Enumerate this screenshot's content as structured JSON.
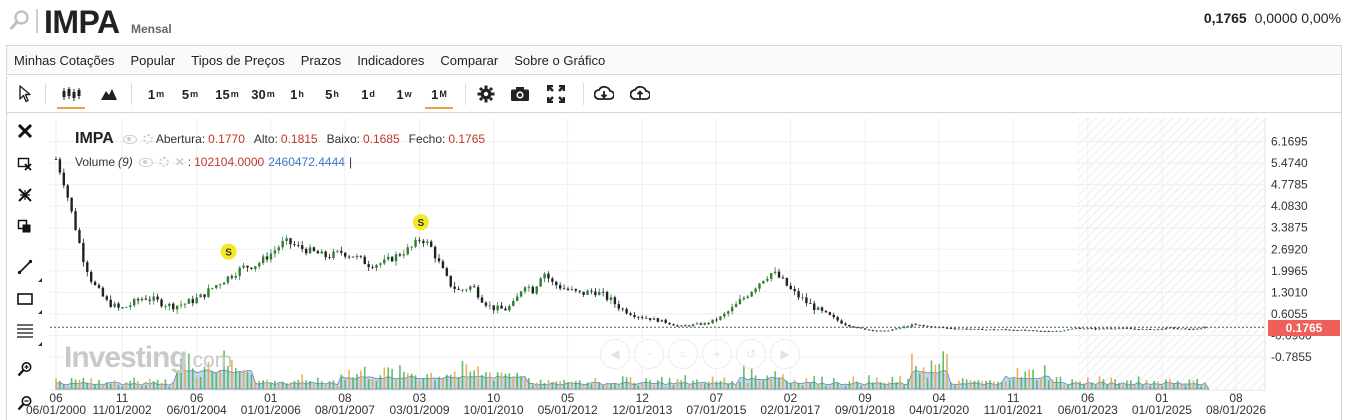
{
  "header": {
    "symbol": "IMPA",
    "period": "Mensal",
    "last": "0,1765",
    "change": "0,0000",
    "change_pct": "0,00%"
  },
  "menu": [
    "Minhas Cotações",
    "Popular",
    "Tipos de Preços",
    "Prazos",
    "Indicadores",
    "Comparar",
    "Sobre o Gráfico"
  ],
  "toolbar": {
    "intervals": [
      {
        "n": "1",
        "u": "m"
      },
      {
        "n": "5",
        "u": "m"
      },
      {
        "n": "15",
        "u": "m"
      },
      {
        "n": "30",
        "u": "m"
      },
      {
        "n": "1",
        "u": "h"
      },
      {
        "n": "5",
        "u": "h"
      },
      {
        "n": "1",
        "u": "d"
      },
      {
        "n": "1",
        "u": "w"
      },
      {
        "n": "1",
        "u": "M"
      }
    ],
    "active_interval": "1M",
    "icons": [
      "cursor-icon",
      "candlestick-icon",
      "mountain-chart-icon",
      "settings-gear-icon",
      "camera-icon",
      "fullscreen-icon",
      "download-icon",
      "upload-icon"
    ]
  },
  "left_tools": [
    "close-icon",
    "delete-drawing-icon",
    "remove-all-icon",
    "copy-icon",
    "trendline-icon",
    "rectangle-icon",
    "fibonacci-icon",
    "zoom-in-icon",
    "zoom-out-icon"
  ],
  "legend": {
    "name": "IMPA",
    "open_label": "Abertura:",
    "open": "0.1770",
    "high_label": "Alto:",
    "high": "0.1815",
    "low_label": "Baixo:",
    "low": "0.1685",
    "close_label": "Fecho:",
    "close": "0.1765",
    "volume_label": "Volume",
    "volume_period": "(9)",
    "volume_sep": ":",
    "volume_value": "102104.0000",
    "volume_ma": "2460472.4444",
    "volume_cursor": "|"
  },
  "price_tag": "0.1765",
  "watermark": {
    "brand": "Investing",
    "domain": ".com"
  },
  "colors": {
    "up": "#2e7d32",
    "down": "#222222",
    "volume_up": "#4caf50",
    "volume_down": "#e8a33d",
    "volume_area": "#7ea3d8",
    "price_tag": "#f0605a",
    "marker": "#f4e922",
    "accent": "#e8a33d"
  },
  "chart_data": {
    "type": "line",
    "y_axis": {
      "ticks": [
        "6.1695",
        "5.4740",
        "4.7785",
        "4.0830",
        "3.3875",
        "2.6920",
        "1.9965",
        "1.3010",
        "0.6055",
        "-0.0900",
        "-0.7855"
      ],
      "tick_values": [
        6.1695,
        5.474,
        4.7785,
        4.083,
        3.3875,
        2.692,
        1.9965,
        1.301,
        0.6055,
        -0.09,
        -0.7855
      ],
      "range": [
        -0.7855,
        6.1695
      ]
    },
    "x_axis": {
      "months": [
        "06",
        "11",
        "06",
        "01",
        "08",
        "03",
        "10",
        "05",
        "12",
        "07",
        "02",
        "09",
        "04",
        "11",
        "06",
        "01",
        "08"
      ],
      "dates": [
        "06/01/2000",
        "11/01/2002",
        "06/01/2004",
        "01/01/2006",
        "08/01/2007",
        "03/01/2009",
        "10/01/2010",
        "05/01/2012",
        "12/01/2013",
        "07/01/2015",
        "02/01/2017",
        "09/01/2018",
        "04/01/2020",
        "11/01/2021",
        "06/01/2023",
        "01/01/2025",
        "08/01/2026"
      ],
      "tick_years": [
        2000.42,
        2001.83,
        2003.42,
        2005.0,
        2006.58,
        2008.17,
        2009.75,
        2011.33,
        2012.92,
        2014.5,
        2016.08,
        2017.67,
        2019.25,
        2020.83,
        2022.42,
        2024.0,
        2025.58
      ]
    },
    "series": [
      {
        "name": "IMPA",
        "points": [
          [
            2000.42,
            5.6
          ],
          [
            2000.6,
            4.8
          ],
          [
            2000.8,
            3.6
          ],
          [
            2001.0,
            2.4
          ],
          [
            2001.2,
            1.6
          ],
          [
            2001.5,
            1.0
          ],
          [
            2001.8,
            0.75
          ],
          [
            2002.0,
            0.9
          ],
          [
            2002.3,
            1.15
          ],
          [
            2002.6,
            1.0
          ],
          [
            2002.9,
            0.85
          ],
          [
            2003.2,
            0.95
          ],
          [
            2003.5,
            1.15
          ],
          [
            2003.8,
            1.5
          ],
          [
            2004.1,
            1.8
          ],
          [
            2004.4,
            2.1
          ],
          [
            2004.7,
            2.2
          ],
          [
            2005.0,
            2.55
          ],
          [
            2005.3,
            2.95
          ],
          [
            2005.6,
            2.75
          ],
          [
            2005.9,
            2.6
          ],
          [
            2006.2,
            2.45
          ],
          [
            2006.5,
            2.6
          ],
          [
            2006.8,
            2.45
          ],
          [
            2007.1,
            2.2
          ],
          [
            2007.4,
            2.25
          ],
          [
            2007.7,
            2.5
          ],
          [
            2008.0,
            2.75
          ],
          [
            2008.2,
            3.05
          ],
          [
            2008.4,
            2.8
          ],
          [
            2008.6,
            2.2
          ],
          [
            2008.8,
            1.6
          ],
          [
            2009.0,
            1.35
          ],
          [
            2009.3,
            1.5
          ],
          [
            2009.5,
            1.1
          ],
          [
            2009.7,
            0.8
          ],
          [
            2010.0,
            0.75
          ],
          [
            2010.2,
            0.95
          ],
          [
            2010.4,
            1.6
          ],
          [
            2010.6,
            1.35
          ],
          [
            2010.8,
            2.0
          ],
          [
            2011.0,
            1.6
          ],
          [
            2011.3,
            1.4
          ],
          [
            2011.6,
            1.25
          ],
          [
            2011.9,
            1.35
          ],
          [
            2012.2,
            1.1
          ],
          [
            2012.5,
            0.75
          ],
          [
            2012.8,
            0.55
          ],
          [
            2013.1,
            0.45
          ],
          [
            2013.4,
            0.35
          ],
          [
            2013.7,
            0.2
          ],
          [
            2014.0,
            0.25
          ],
          [
            2014.3,
            0.3
          ],
          [
            2014.6,
            0.5
          ],
          [
            2014.9,
            0.85
          ],
          [
            2015.2,
            1.3
          ],
          [
            2015.5,
            1.75
          ],
          [
            2015.7,
            1.95
          ],
          [
            2015.9,
            1.7
          ],
          [
            2016.1,
            1.35
          ],
          [
            2016.4,
            1.0
          ],
          [
            2016.7,
            0.7
          ],
          [
            2016.9,
            0.55
          ],
          [
            2017.2,
            0.3
          ],
          [
            2017.5,
            0.15
          ],
          [
            2017.8,
            0.08
          ],
          [
            2018.1,
            0.05
          ],
          [
            2018.4,
            0.15
          ],
          [
            2018.7,
            0.25
          ],
          [
            2019.0,
            0.2
          ],
          [
            2019.4,
            0.15
          ],
          [
            2019.8,
            0.12
          ],
          [
            2020.2,
            0.1
          ],
          [
            2020.6,
            0.1
          ],
          [
            2021.0,
            0.08
          ],
          [
            2021.4,
            0.05
          ],
          [
            2021.8,
            0.05
          ],
          [
            2022.2,
            0.15
          ],
          [
            2022.6,
            0.12
          ],
          [
            2023.0,
            0.15
          ],
          [
            2023.4,
            0.12
          ],
          [
            2023.8,
            0.1
          ],
          [
            2024.2,
            0.15
          ],
          [
            2024.6,
            0.1
          ],
          [
            2025.0,
            0.18
          ]
        ]
      }
    ],
    "last_value": 0.1765,
    "markers": [
      {
        "label": "S",
        "x": 2004.1,
        "y": 2.1
      },
      {
        "label": "S",
        "x": 2008.2,
        "y": 3.05
      }
    ],
    "volume_series": {
      "name": "Volume",
      "period": 9
    },
    "grid": true
  }
}
